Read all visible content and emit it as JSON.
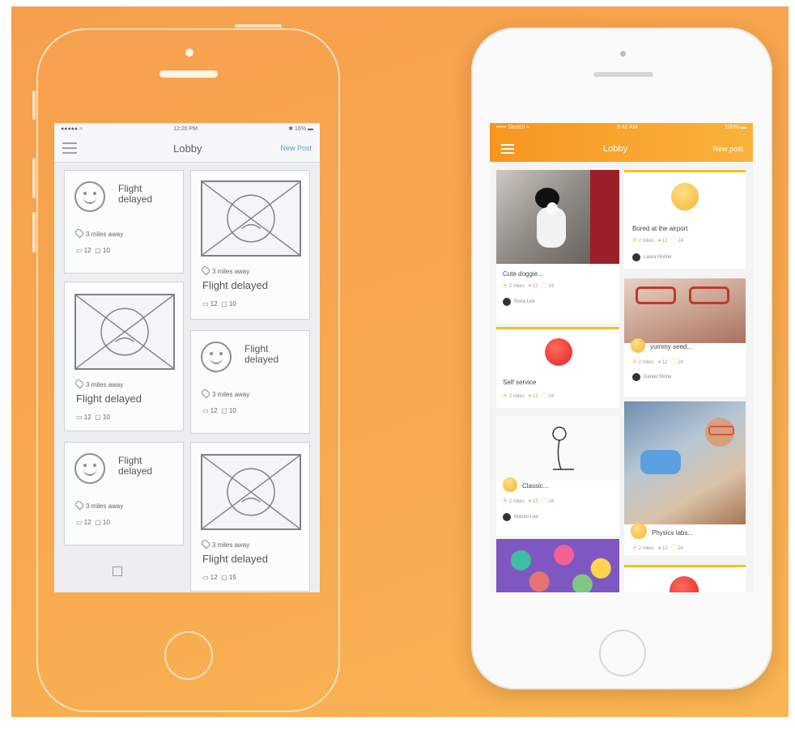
{
  "wireframe": {
    "status": {
      "carrier": "●●●●● ≈",
      "time": "12:20 PM",
      "battery": "✱ 16% ▬"
    },
    "nav": {
      "title": "Lobby",
      "new_post": "New Post"
    },
    "cards": [
      {
        "kind": "emoji",
        "label_line1": "Flight",
        "label_line2": "delayed",
        "distance": "3 miles away",
        "likes": "12",
        "comments": "10"
      },
      {
        "kind": "image",
        "distance": "3 miles away",
        "label": "Flight delayed",
        "likes": "12",
        "comments": "10"
      },
      {
        "kind": "image",
        "distance": "3 miles away",
        "label": "Flight delayed",
        "likes": "12",
        "comments": "10"
      },
      {
        "kind": "emoji",
        "label_line1": "Flight",
        "label_line2": "delayed",
        "distance": "3 miles away",
        "likes": "12",
        "comments": "10"
      },
      {
        "kind": "emoji",
        "label_line1": "Flight",
        "label_line2": "delayed",
        "distance": "3 miles away",
        "likes": "12",
        "comments": "10"
      },
      {
        "kind": "image",
        "distance": "3 miles away",
        "label": "Flight delayed",
        "likes": "12",
        "comments": "15"
      }
    ]
  },
  "app": {
    "status": {
      "carrier": "••••• Sketch ≈",
      "time": "9:41 AM",
      "battery": "100% ▬"
    },
    "nav": {
      "title": "Lobby",
      "new_post": "New post"
    },
    "cards": [
      {
        "caption": "Cute doggie...",
        "meta_dist": "2 miles",
        "meta_likes": "12",
        "meta_comments": "24",
        "author": "Rosa Lee"
      },
      {
        "caption": "Bored at the airport",
        "meta_dist": "2 miles",
        "meta_likes": "12",
        "meta_comments": "24",
        "author": "Laura Hunter"
      },
      {
        "caption": "Self service",
        "meta_dist": "2 miles",
        "meta_likes": "12",
        "meta_comments": "24"
      },
      {
        "caption": "yummy seed...",
        "meta_dist": "2 miles",
        "meta_likes": "12",
        "meta_comments": "24",
        "author": "Daniel Stone"
      },
      {
        "caption": "Classic...",
        "meta_dist": "2 miles",
        "meta_likes": "12",
        "meta_comments": "24",
        "author": "Mason Lee"
      },
      {
        "caption": "Physics labs...",
        "meta_dist": "2 miles",
        "meta_likes": "12",
        "meta_comments": "24"
      }
    ]
  },
  "colors": {
    "background": "#f8a94f",
    "accent": "#f7951f",
    "highlight": "#f5c21b",
    "bad_emoji": "#e53935"
  }
}
